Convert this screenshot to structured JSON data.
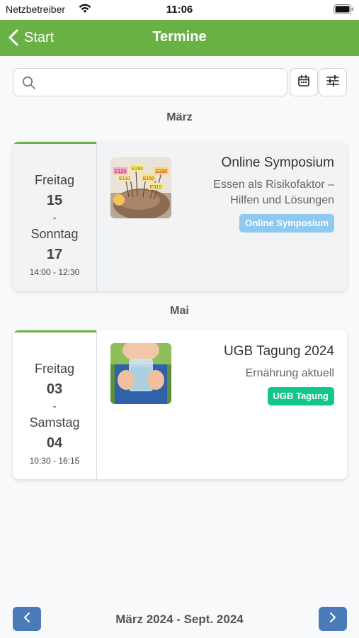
{
  "status_bar": {
    "carrier": "Netzbetreiber",
    "time": "11:06",
    "icons": [
      "wifi-icon",
      "battery-icon"
    ]
  },
  "nav": {
    "back_label": "Start",
    "title": "Termine",
    "color": "#69b145"
  },
  "search": {
    "placeholder": "",
    "value": ""
  },
  "toolbar": {
    "icons": [
      "calendar-icon",
      "filter-sliders-icon"
    ]
  },
  "groups": [
    {
      "month": "März",
      "events": [
        {
          "weekday_start": "Freitag",
          "day_start": "15",
          "separator": "-",
          "weekday_end": "Sonntag",
          "day_end": "17",
          "time": "14:00 - 12:30",
          "title": "Online Symposium",
          "subtitle_line1": "Essen als Risikofaktor –",
          "subtitle_line2": "Hilfen und Lösungen",
          "badge": "Online Symposium",
          "badge_color": "#8fc9f0",
          "image": "food-additives-thumbnail",
          "thumb_labels": [
            "E129",
            "E280",
            "E330",
            "E110",
            "E150",
            "E310"
          ]
        }
      ]
    },
    {
      "month": "Mai",
      "events": [
        {
          "weekday_start": "Freitag",
          "day_start": "03",
          "separator": "-",
          "weekday_end": "Samstag",
          "day_end": "04",
          "time": "10:30 - 16:15",
          "title": "UGB Tagung 2024",
          "subtitle_line1": "Ernährung aktuell",
          "badge": "UGB Tagung",
          "badge_color": "#12c78b",
          "image": "child-drinking-water-thumbnail"
        }
      ]
    }
  ],
  "pager": {
    "label": "März 2024 - Sept. 2024",
    "prev_icon": "chevron-left-icon",
    "next_icon": "chevron-right-icon",
    "color": "#4a7ab8"
  }
}
